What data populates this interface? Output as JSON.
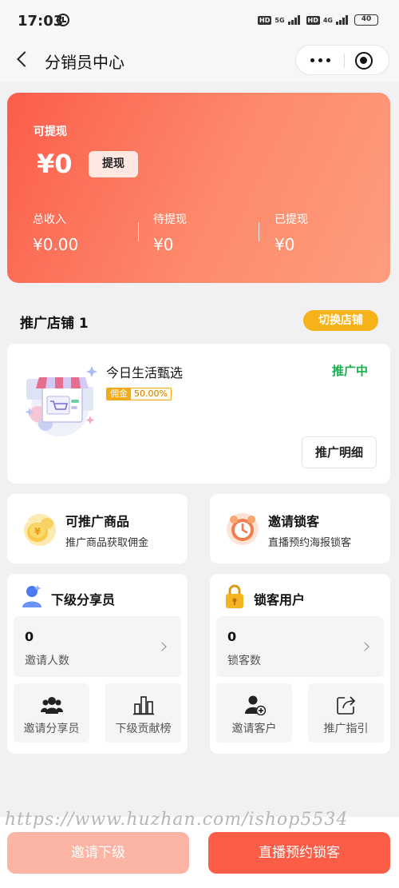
{
  "status_bar": {
    "time": "17:03",
    "hd1": "HD",
    "net1": "5G",
    "hd2": "HD",
    "net2": "4G",
    "battery": "40"
  },
  "nav": {
    "title": "分销员中心"
  },
  "balance": {
    "withdrawable_label": "可提现",
    "withdrawable_amount": "¥0",
    "withdraw_button": "提现",
    "stats": [
      {
        "label": "总收入",
        "value": "¥0.00"
      },
      {
        "label": "待提现",
        "value": "¥0"
      },
      {
        "label": "已提现",
        "value": "¥0"
      }
    ]
  },
  "store": {
    "header_title": "推广店铺 1",
    "switch_button": "切换店铺",
    "name": "今日生活甄选",
    "commission_tag": "佣金",
    "commission_rate": "50.00%",
    "status": "推广中",
    "detail_button": "推广明细"
  },
  "features": [
    {
      "title": "可推广商品",
      "subtitle": "推广商品获取佣金"
    },
    {
      "title": "邀请锁客",
      "subtitle": "直播预约海报锁客"
    }
  ],
  "panels": {
    "sub_sharers": {
      "title": "下级分享员",
      "count": "0",
      "count_label": "邀请人数",
      "actions": [
        "邀请分享员",
        "下级贡献榜"
      ]
    },
    "locked_users": {
      "title": "锁客用户",
      "count": "0",
      "count_label": "锁客数",
      "actions": [
        "邀请客户",
        "推广指引"
      ]
    }
  },
  "watermark": "https://www.huzhan.com/ishop5534",
  "bottom": {
    "invite_button": "邀请下级",
    "live_button": "直播预约锁客"
  },
  "colors": {
    "accent": "#fb5d47",
    "gold": "#f6b219",
    "status_green": "#14b24a"
  }
}
